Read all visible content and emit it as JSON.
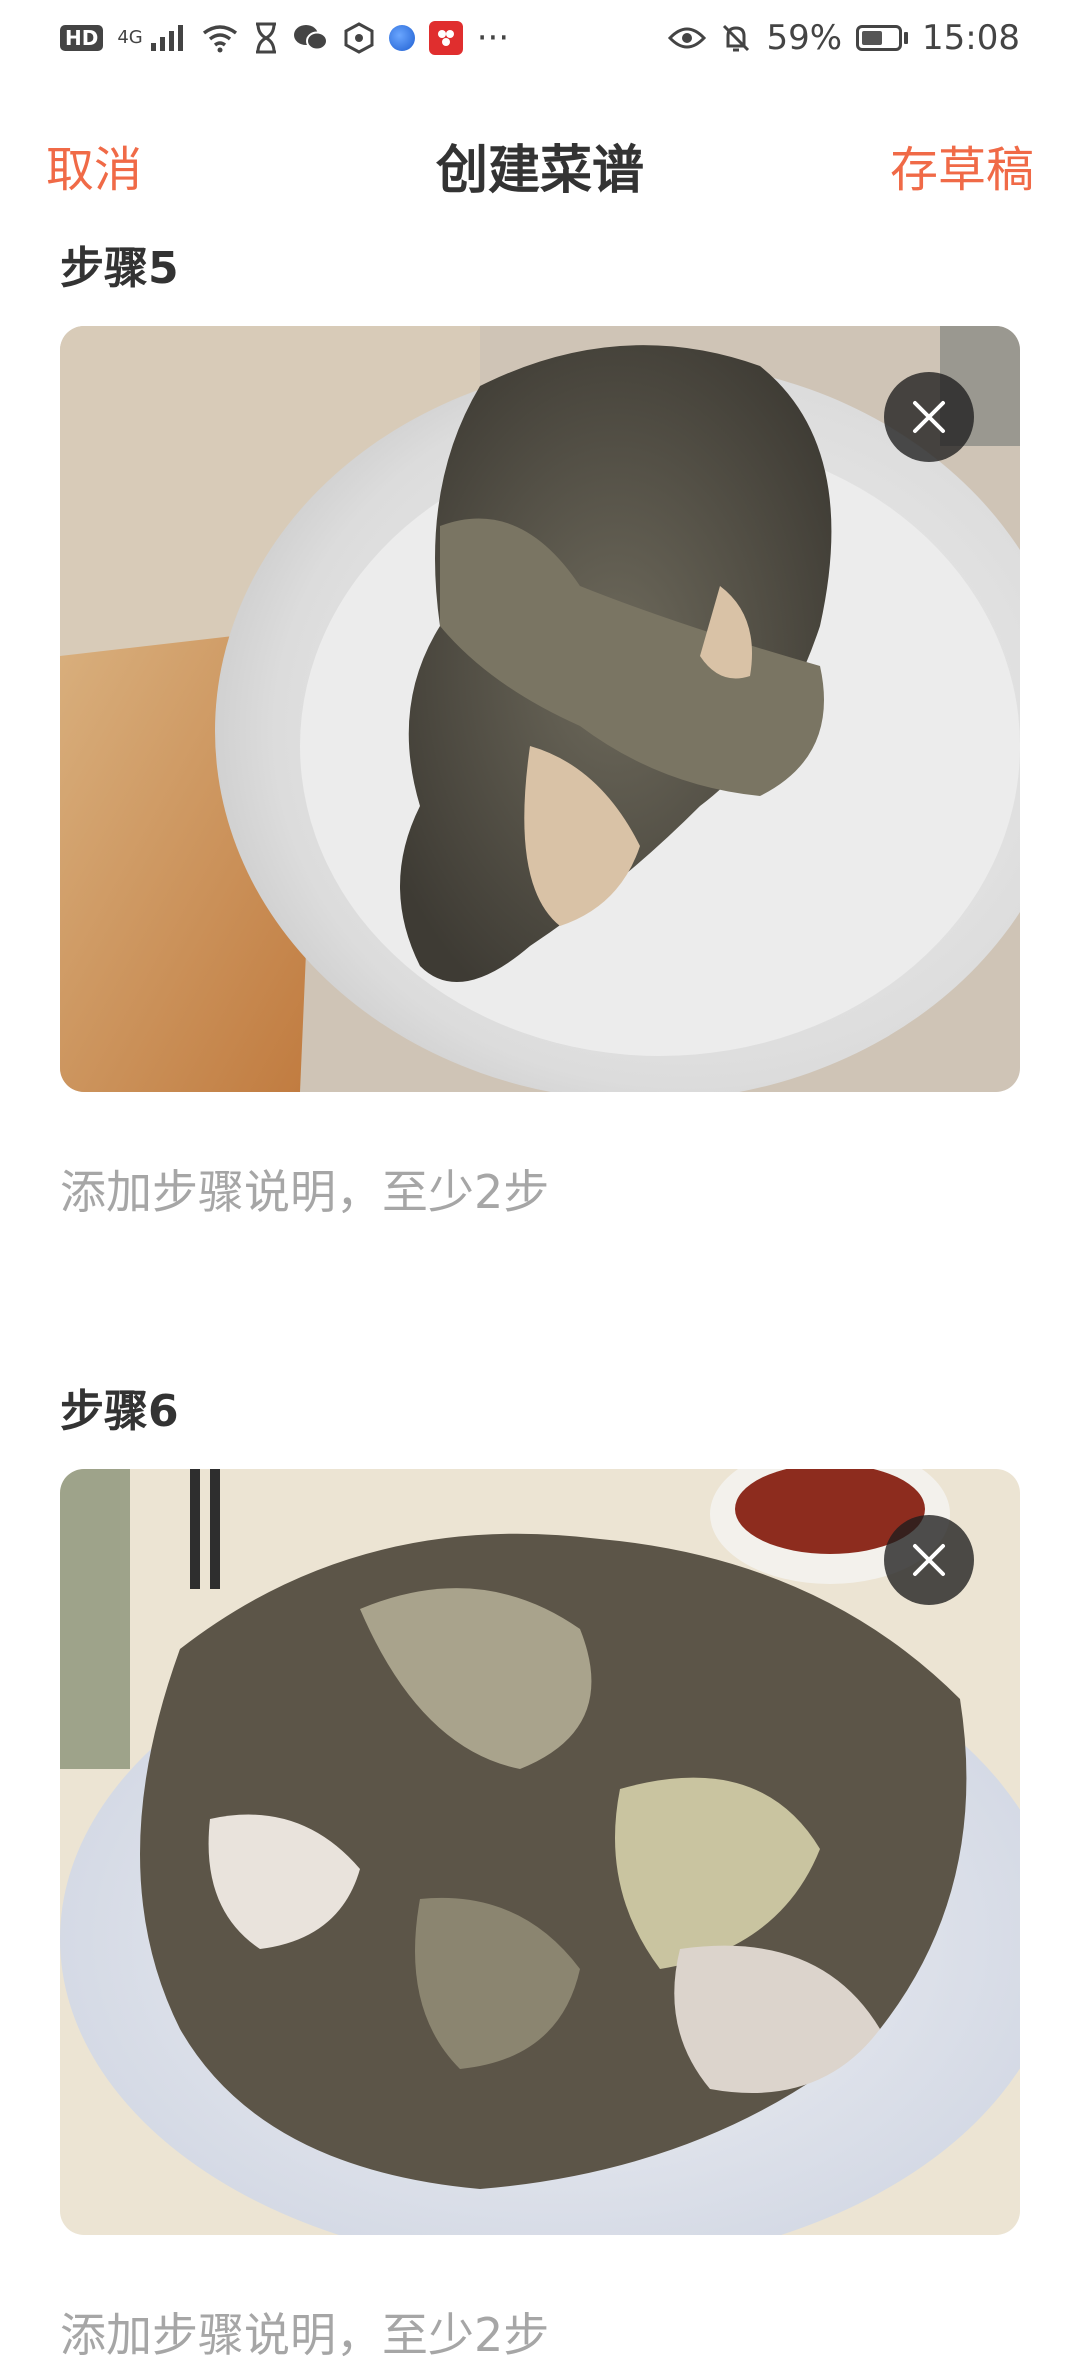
{
  "status_bar": {
    "hd": "HD",
    "network": "4G",
    "battery_text": "59%",
    "time": "15:08",
    "battery_level": 0.59,
    "more": "···"
  },
  "header": {
    "cancel": "取消",
    "title": "创建菜谱",
    "save_draft": "存草稿"
  },
  "steps": [
    {
      "title": "步骤5",
      "description_placeholder": "添加步骤说明，至少2步"
    },
    {
      "title": "步骤6",
      "description_placeholder": "添加步骤说明，至少2步"
    }
  ],
  "colors": {
    "accent": "#f06a47",
    "title": "#333333",
    "placeholder": "#a6a6a6"
  }
}
